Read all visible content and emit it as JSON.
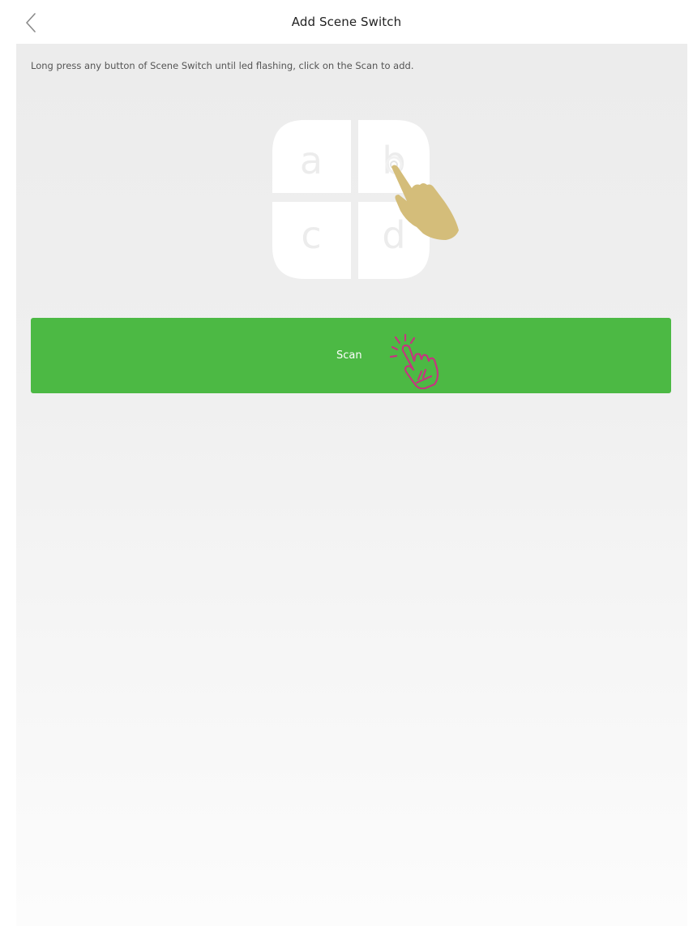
{
  "header": {
    "title": "Add Scene Switch",
    "back_icon": "chevron-left-icon"
  },
  "main": {
    "hint": "Long press any button of Scene Switch until led flashing, click on the Scan to add.",
    "illustration": {
      "keys": [
        "a",
        "b",
        "c",
        "d"
      ],
      "hand_icon": "tap-hand-icon",
      "hand_color": "#d4bd7a"
    },
    "scan_button": {
      "label": "Scan",
      "color": "#4cb944",
      "hand_icon": "click-hand-icon",
      "hand_color": "#c5357f"
    }
  }
}
